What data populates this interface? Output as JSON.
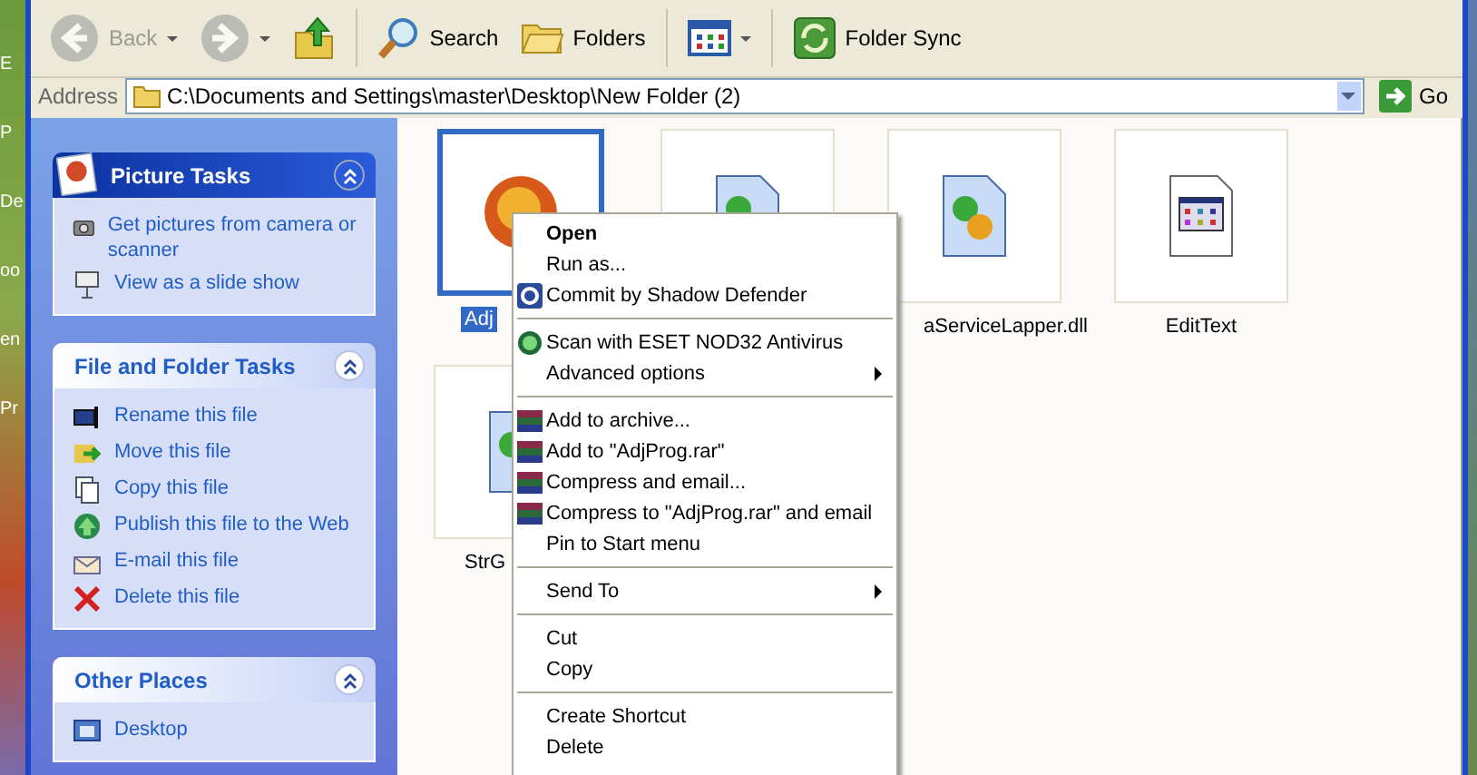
{
  "desktop": {
    "labels": [
      "E",
      "P",
      "De",
      "oo",
      "en",
      "Pr"
    ]
  },
  "toolbar": {
    "buttons": [
      {
        "kind": "back",
        "label": "Back",
        "disabled": true,
        "dropdown": true
      },
      {
        "kind": "forward",
        "disabled": true,
        "dropdown": true
      },
      {
        "kind": "up",
        "disabled": false,
        "dropdown": false
      },
      {
        "kind": "search",
        "label": "Search",
        "disabled": false,
        "dropdown": false
      },
      {
        "kind": "folders",
        "label": "Folders",
        "disabled": false,
        "dropdown": false
      },
      {
        "kind": "views",
        "disabled": false,
        "dropdown": true
      },
      {
        "kind": "sync",
        "label": "Folder Sync",
        "disabled": false,
        "dropdown": false
      }
    ]
  },
  "address": {
    "label": "Address",
    "value": "C:\\Documents and Settings\\master\\Desktop\\New Folder (2)",
    "go": "Go"
  },
  "task_panels": [
    {
      "kind": "special",
      "title": "Picture Tasks",
      "expanded": true,
      "items": [
        {
          "kind": "camera",
          "label": "Get pictures from camera or scanner"
        },
        {
          "kind": "slideshow",
          "label": "View as a slide show"
        }
      ]
    },
    {
      "kind": "normal",
      "title": "File and Folder Tasks",
      "expanded": true,
      "items": [
        {
          "kind": "rename",
          "label": "Rename this file"
        },
        {
          "kind": "move",
          "label": "Move this file"
        },
        {
          "kind": "copy",
          "label": "Copy this file"
        },
        {
          "kind": "publish",
          "label": "Publish this file to the Web"
        },
        {
          "kind": "email",
          "label": "E-mail this file"
        },
        {
          "kind": "delete",
          "label": "Delete this file"
        }
      ]
    },
    {
      "kind": "normal",
      "title": "Other Places",
      "expanded": true,
      "items": [
        {
          "kind": "place",
          "label": "Desktop"
        }
      ]
    }
  ],
  "files": [
    {
      "kind": "application",
      "name": "Adj",
      "selected": true
    },
    {
      "kind": "library",
      "selected": false
    },
    {
      "kind": "library",
      "name": "aServiceLapper.dll",
      "selected": false
    },
    {
      "kind": "window",
      "name": "EditText",
      "selected": false
    },
    {
      "kind": "library",
      "name": "StrG",
      "selected": false
    }
  ],
  "context_menu": {
    "items": [
      {
        "kind": "plain",
        "label": "Open",
        "bold": true
      },
      {
        "kind": "plain",
        "label": "Run as..."
      },
      {
        "kind": "shadow",
        "label": "Commit by Shadow Defender"
      },
      {
        "kind": "separator"
      },
      {
        "kind": "antivirus",
        "label": "Scan with ESET NOD32 Antivirus"
      },
      {
        "kind": "plain",
        "label": "Advanced options",
        "submenu": true
      },
      {
        "kind": "separator"
      },
      {
        "kind": "archive",
        "label": "Add to archive..."
      },
      {
        "kind": "archive",
        "label": "Add to \"AdjProg.rar\""
      },
      {
        "kind": "archive",
        "label": "Compress and email..."
      },
      {
        "kind": "archive",
        "label": "Compress to \"AdjProg.rar\" and email"
      },
      {
        "kind": "plain",
        "label": "Pin to Start menu"
      },
      {
        "kind": "separator"
      },
      {
        "kind": "plain",
        "label": "Send To",
        "submenu": true
      },
      {
        "kind": "separator"
      },
      {
        "kind": "plain",
        "label": "Cut"
      },
      {
        "kind": "plain",
        "label": "Copy"
      },
      {
        "kind": "separator"
      },
      {
        "kind": "plain",
        "label": "Create Shortcut"
      },
      {
        "kind": "plain",
        "label": "Delete"
      }
    ]
  }
}
